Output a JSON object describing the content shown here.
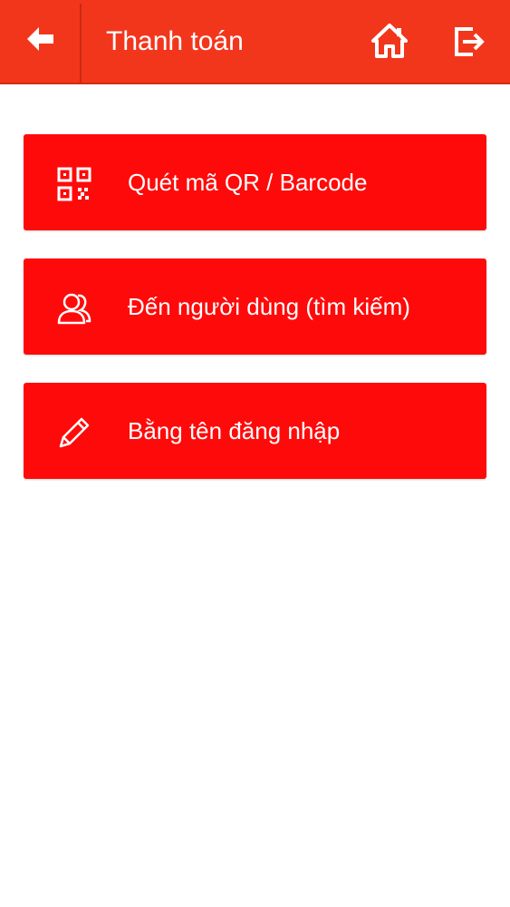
{
  "header": {
    "title": "Thanh toán",
    "back_icon": "arrow-left-icon",
    "home_icon": "home-icon",
    "logout_icon": "logout-icon"
  },
  "menu": {
    "items": [
      {
        "label": "Quét mã QR / Barcode",
        "icon": "qr-code-icon"
      },
      {
        "label": "Đến người dùng (tìm kiếm)",
        "icon": "users-icon"
      },
      {
        "label": "Bằng tên đăng nhập",
        "icon": "pencil-icon"
      }
    ]
  },
  "colors": {
    "header_bg": "#f2361c",
    "button_bg": "#ff0a0a",
    "text": "#ffffff",
    "page_bg": "#ffffff"
  }
}
